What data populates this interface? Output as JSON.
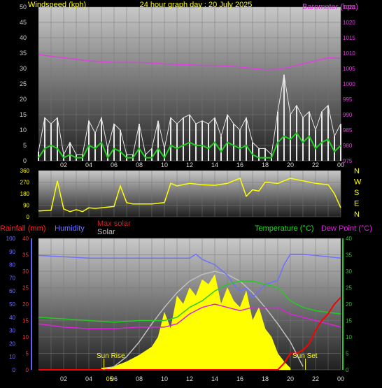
{
  "colors": {
    "wind_axis": "#cccccc",
    "gust": "#e8e8e8",
    "avg_wind": "#1fcf1f",
    "baro": "#e040e0",
    "wind_dir": "#ffff00",
    "rain": "#ff0000",
    "humidity": "#7070ff",
    "max_solar": "#c0c0c0",
    "solar": "#ffff00",
    "temperature": "#22cc22",
    "dew_point": "#e020e0",
    "title": "#ffff00"
  },
  "chart_data": [
    {
      "type": "line",
      "title": "24 hour graph day : 20 July 2025",
      "ylabel": "Windspeed (kph)",
      "y2label": "Barometer (hpa)",
      "ylim": [
        0,
        50
      ],
      "y2lim": [
        975,
        1025
      ],
      "y_ticks": [
        "0",
        "5",
        "10",
        "15",
        "20",
        "25",
        "30",
        "35",
        "40",
        "45",
        "50"
      ],
      "y2_ticks": [
        "975",
        "980",
        "985",
        "990",
        "995",
        "1000",
        "1005",
        "1010",
        "1015",
        "1020",
        "1025"
      ],
      "x_ticks": [
        "02",
        "04",
        "06",
        "08",
        "10",
        "12",
        "14",
        "16",
        "18",
        "20",
        "22",
        "00"
      ],
      "grid": true,
      "series": [
        {
          "name": "Gust",
          "x": [
            0,
            0.5,
            1,
            1.5,
            2,
            2.5,
            3,
            3.5,
            4,
            4.5,
            5,
            5.5,
            6,
            6.5,
            7,
            7.5,
            8,
            8.5,
            9,
            9.5,
            10,
            10.5,
            11,
            11.5,
            12,
            12.5,
            13,
            13.5,
            14,
            14.5,
            15,
            15.5,
            16,
            16.5,
            17,
            17.5,
            18,
            18.5,
            19,
            19.5,
            20,
            20.5,
            21,
            21.5,
            22,
            22.5,
            23,
            23.5,
            24
          ],
          "values": [
            3,
            14,
            12,
            14,
            2,
            6,
            2,
            2,
            13,
            9,
            14,
            4,
            12,
            10,
            2,
            2,
            12,
            2,
            4,
            13,
            4,
            14,
            12,
            14,
            15,
            12,
            13,
            12,
            14,
            8,
            15,
            12,
            10,
            14,
            6,
            4,
            4,
            2,
            16,
            28,
            15,
            18,
            14,
            16,
            10,
            16,
            18,
            8,
            12
          ]
        },
        {
          "name": "Average",
          "x": [
            0,
            0.5,
            1,
            1.5,
            2,
            2.5,
            3,
            3.5,
            4,
            4.5,
            5,
            5.5,
            6,
            6.5,
            7,
            7.5,
            8,
            8.5,
            9,
            9.5,
            10,
            10.5,
            11,
            11.5,
            12,
            12.5,
            13,
            13.5,
            14,
            14.5,
            15,
            15.5,
            16,
            16.5,
            17,
            17.5,
            18,
            18.5,
            19,
            19.5,
            20,
            20.5,
            21,
            21.5,
            22,
            22.5,
            23,
            23.5,
            24
          ],
          "values": [
            1,
            4,
            5,
            4,
            1,
            2,
            1,
            1,
            5,
            4,
            6,
            1,
            4,
            3,
            1,
            1,
            4,
            1,
            1,
            4,
            1,
            5,
            4,
            5,
            6,
            5,
            5,
            4,
            6,
            3,
            6,
            5,
            4,
            5,
            2,
            1,
            1,
            1,
            6,
            8,
            7,
            9,
            6,
            8,
            4,
            6,
            7,
            3,
            5
          ]
        },
        {
          "name": "Barometer",
          "axis": "right",
          "x": [
            0,
            1,
            2,
            3,
            4,
            5,
            6,
            7,
            8,
            9,
            10,
            11,
            12,
            13,
            14,
            15,
            16,
            17,
            18,
            19,
            20,
            21,
            22,
            23,
            24
          ],
          "values": [
            1009.5,
            1009,
            1008.5,
            1008,
            1007.5,
            1007.2,
            1007,
            1007,
            1007,
            1006.8,
            1006.5,
            1006.3,
            1006.2,
            1006,
            1006,
            1005.8,
            1005.5,
            1005,
            1004.6,
            1004.7,
            1005.5,
            1006.5,
            1007.5,
            1008.5,
            1008.3
          ]
        }
      ]
    },
    {
      "type": "line",
      "title": "",
      "ylim": [
        0,
        360
      ],
      "y_ticks": [
        "0",
        "90",
        "180",
        "270",
        "360"
      ],
      "right_labels": [
        "N",
        "W",
        "S",
        "E",
        "N"
      ],
      "grid": true,
      "series": [
        {
          "name": "Wind direction",
          "x": [
            0,
            1,
            1.5,
            2,
            2.5,
            3,
            3.5,
            4,
            4.5,
            5,
            6,
            6.5,
            7,
            7.5,
            8,
            9,
            10,
            10.5,
            11,
            12,
            13,
            14,
            15,
            15.5,
            16,
            16.5,
            17,
            17.5,
            18,
            19,
            20,
            21,
            22,
            23,
            23.5,
            24
          ],
          "values": [
            45,
            50,
            280,
            60,
            40,
            55,
            40,
            70,
            65,
            70,
            80,
            240,
            110,
            100,
            100,
            100,
            110,
            260,
            240,
            260,
            250,
            245,
            260,
            280,
            300,
            160,
            210,
            200,
            270,
            260,
            300,
            280,
            260,
            250,
            180,
            70
          ]
        }
      ]
    },
    {
      "type": "line",
      "title": "",
      "ylabel": "Rainfall (mm)",
      "y2label": "Temperature (°C)",
      "ylim": [
        0,
        40
      ],
      "rain_ticks": [
        "0",
        "5",
        "10",
        "15",
        "20",
        "25",
        "30",
        "35",
        "40"
      ],
      "humidity_ticks": [
        "0",
        "10",
        "20",
        "30",
        "40",
        "50",
        "60",
        "70",
        "80",
        "90",
        "100"
      ],
      "y2_ticks": [
        "0",
        "5",
        "10",
        "15",
        "20",
        "25",
        "30",
        "35",
        "40"
      ],
      "x_ticks": [
        "02",
        "04",
        "06",
        "08",
        "10",
        "12",
        "14",
        "16",
        "18",
        "20",
        "22",
        "00"
      ],
      "annotations": [
        {
          "text": "Sun Rise",
          "x": 5.2
        },
        {
          "text": "Sun Set",
          "x": 21.2
        },
        {
          "text": "05",
          "x": 5.2
        }
      ],
      "legend": [
        "Humidity",
        "Max solar",
        "Solar",
        "Dew Point (°C)"
      ],
      "grid": true,
      "series": [
        {
          "name": "Rainfall",
          "axis": "rain",
          "x": [
            0,
            19,
            19.5,
            20,
            20.5,
            21,
            21.5,
            22,
            22.5,
            23,
            23.5,
            24
          ],
          "values": [
            0,
            0,
            2,
            5,
            5,
            6,
            8,
            12,
            15,
            17,
            20,
            22
          ]
        },
        {
          "name": "Humidity",
          "axis": "humidity",
          "x": [
            0,
            2,
            4,
            6,
            8,
            10,
            11,
            12,
            12.5,
            13,
            14,
            15,
            15.5,
            16,
            16.5,
            17,
            18,
            19,
            19.5,
            20,
            21,
            22,
            23,
            24
          ],
          "values": [
            87,
            86,
            85,
            85,
            85,
            85,
            85,
            85,
            88,
            84,
            80,
            72,
            65,
            60,
            62,
            55,
            65,
            68,
            80,
            88,
            88,
            87,
            86,
            85
          ]
        },
        {
          "name": "Max solar",
          "axis": "solar",
          "x": [
            5,
            6,
            7,
            8,
            9,
            10,
            11,
            12,
            13,
            14,
            15,
            16,
            17,
            18,
            19,
            20,
            21
          ],
          "values": [
            0,
            2,
            8,
            17,
            28,
            38,
            47,
            54,
            58,
            60,
            58,
            54,
            47,
            38,
            28,
            17,
            2
          ]
        },
        {
          "name": "Solar",
          "axis": "solar",
          "x": [
            5,
            6,
            7,
            8,
            9,
            9.5,
            10,
            10.5,
            11,
            11.5,
            12,
            12.5,
            13,
            13.5,
            14,
            14.5,
            15,
            15.5,
            16,
            16.5,
            17,
            17.5,
            18,
            18.5,
            19,
            19.5,
            20
          ],
          "values": [
            1,
            2,
            5,
            9,
            14,
            20,
            35,
            25,
            45,
            40,
            50,
            45,
            55,
            52,
            58,
            40,
            50,
            42,
            38,
            48,
            30,
            38,
            25,
            20,
            10,
            5,
            1
          ]
        },
        {
          "name": "Temperature",
          "axis": "temp",
          "x": [
            0,
            2,
            4,
            6,
            8,
            10,
            11,
            12,
            13,
            14,
            15,
            16,
            17,
            18,
            19,
            20,
            21,
            22,
            23,
            24
          ],
          "values": [
            16,
            15.5,
            15,
            14.5,
            15,
            15,
            16,
            19,
            21,
            24,
            26,
            27,
            27,
            26,
            25,
            21,
            19,
            18,
            17.5,
            17
          ]
        },
        {
          "name": "Dew Point",
          "axis": "temp",
          "x": [
            0,
            2,
            4,
            6,
            8,
            10,
            11,
            12,
            13,
            14,
            15,
            16,
            17,
            18,
            19,
            20,
            21,
            22,
            23,
            24
          ],
          "values": [
            14,
            13,
            12.5,
            12.5,
            13,
            13,
            14,
            17,
            19,
            20,
            19,
            18,
            19,
            19,
            19,
            17,
            16,
            15,
            14,
            13
          ]
        }
      ]
    }
  ],
  "labels": {
    "title": "24 hour graph day : 20 July 2025",
    "windspeed": "Windspeed (kph)",
    "barometer": "Barometer (hpa)",
    "rainfall": "Rainfall (mm)",
    "humidity": "Humidity",
    "max_solar": "Max solar",
    "solar": "Solar",
    "temperature": "Temperature (°C)",
    "dew_point": "Dew Point (°C)",
    "sun_rise": "Sun Rise",
    "sun_set": "Sun Set"
  }
}
